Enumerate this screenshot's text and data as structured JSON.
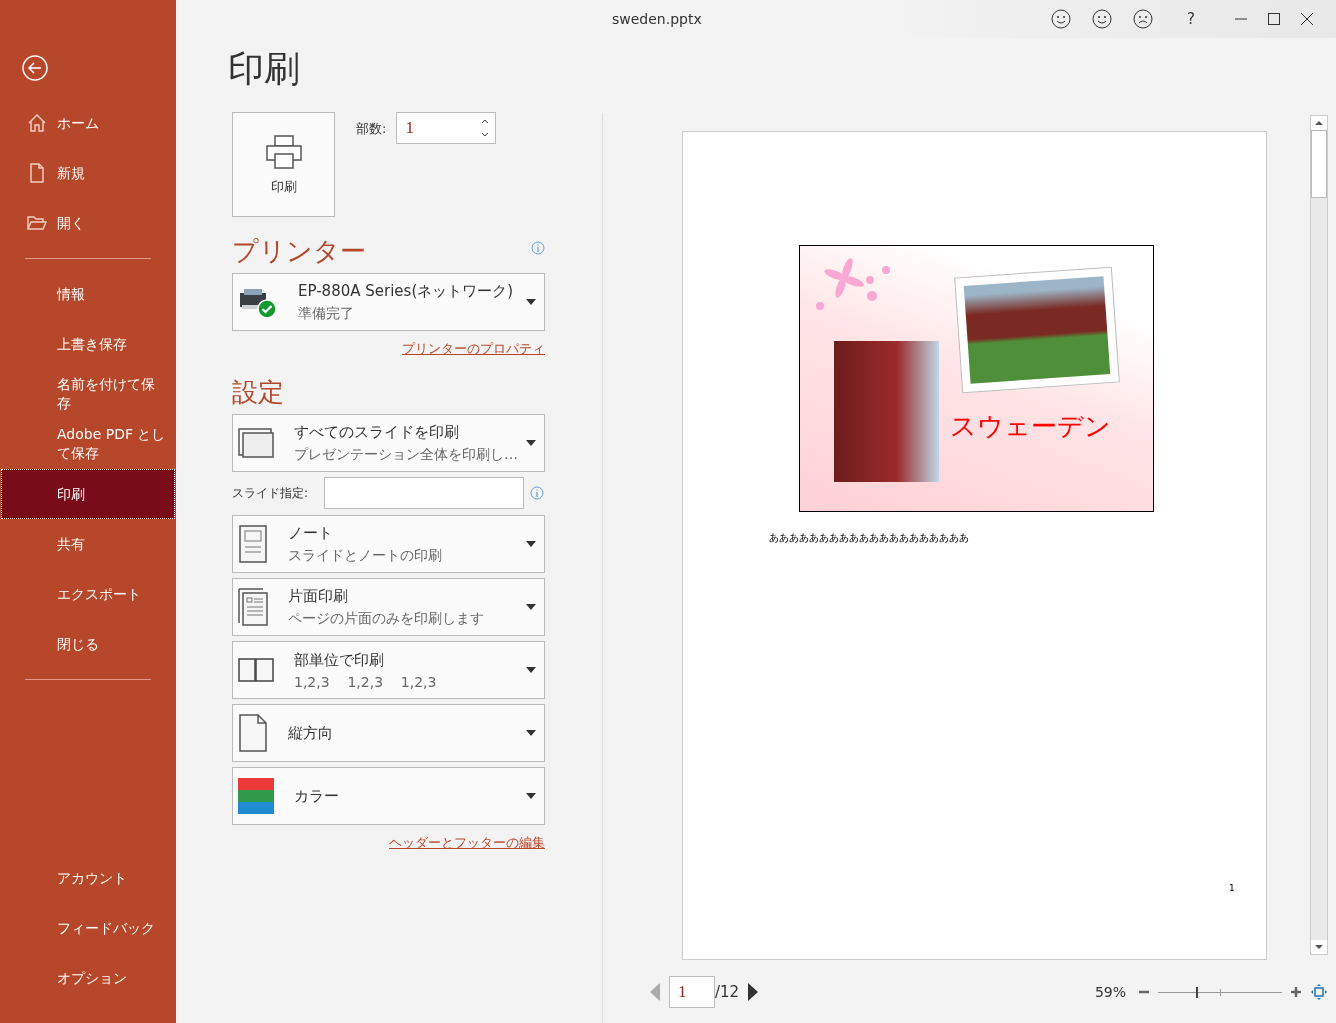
{
  "window": {
    "title": "sweden.pptx",
    "help": "?"
  },
  "sidebar": {
    "groups": [
      {
        "items": [
          {
            "label": "ホーム",
            "kind": "home",
            "selected": false
          },
          {
            "label": "新規",
            "kind": "new",
            "selected": false
          },
          {
            "label": "開く",
            "kind": "open",
            "selected": false
          }
        ]
      },
      {
        "items": [
          {
            "label": "情報",
            "kind": "plain",
            "selected": false
          },
          {
            "label": "上書き保存",
            "kind": "plain",
            "selected": false
          },
          {
            "label": "名前を付けて保存",
            "kind": "plain",
            "selected": false
          },
          {
            "label": "Adobe PDF として保存",
            "kind": "plain",
            "selected": false
          },
          {
            "label": "印刷",
            "kind": "plain",
            "selected": true
          },
          {
            "label": "共有",
            "kind": "plain",
            "selected": false
          },
          {
            "label": "エクスポート",
            "kind": "plain",
            "selected": false
          },
          {
            "label": "閉じる",
            "kind": "plain",
            "selected": false
          }
        ]
      },
      {
        "items": [
          {
            "label": "アカウント",
            "kind": "plain",
            "selected": false
          },
          {
            "label": "フィードバック",
            "kind": "plain",
            "selected": false
          },
          {
            "label": "オプション",
            "kind": "plain",
            "selected": false
          }
        ]
      }
    ]
  },
  "page_title": "印刷",
  "print_button": {
    "label": "印刷"
  },
  "copies": {
    "label": "部数:",
    "value": "1"
  },
  "printer": {
    "heading": "プリンター",
    "name": "EP-880A Series(ネットワーク)",
    "status": "準備完了",
    "properties_link": "プリンターのプロパティ"
  },
  "settings": {
    "heading": "設定",
    "items": [
      {
        "kind": "slides",
        "title": "すべてのスライドを印刷",
        "subtitle": "プレゼンテーション全体を印刷し…"
      },
      {
        "kind": "range",
        "label": "スライド指定:"
      },
      {
        "kind": "notes",
        "title": "ノート",
        "subtitle": "スライドとノートの印刷"
      },
      {
        "kind": "sides",
        "title": "片面印刷",
        "subtitle": "ページの片面のみを印刷します"
      },
      {
        "kind": "collate",
        "title": "部単位で印刷",
        "subtitle": "1,2,3    1,2,3    1,2,3"
      },
      {
        "kind": "orientation",
        "title": "縦方向"
      },
      {
        "kind": "color",
        "title": "カラー"
      }
    ],
    "footer_link": "ヘッダーとフッターの編集"
  },
  "preview": {
    "slide_title": "スウェーデン",
    "notes": "ああああああああああああああああああああ",
    "page_number": "1"
  },
  "navigation": {
    "page": "1",
    "total": "/12",
    "zoom": "59%",
    "level": 0.31
  }
}
